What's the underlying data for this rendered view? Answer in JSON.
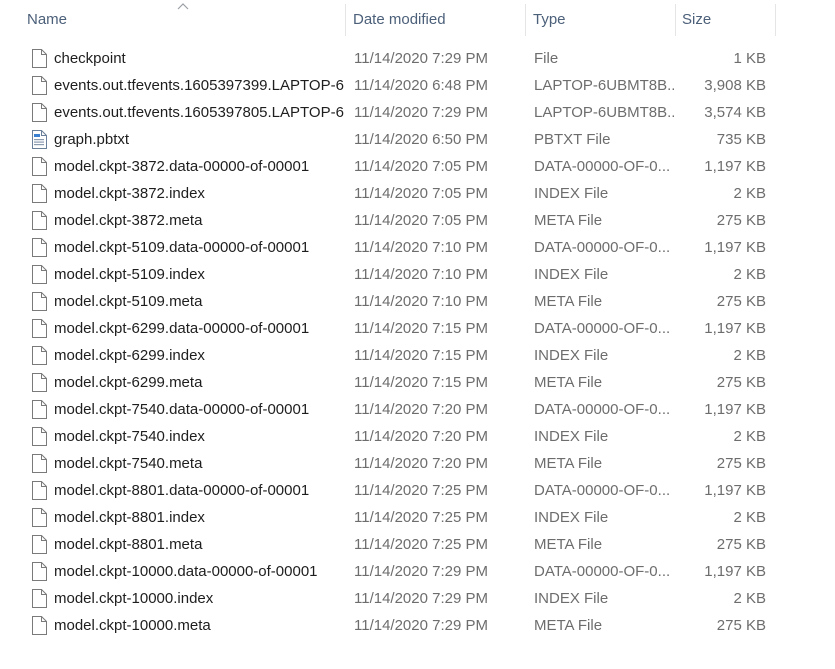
{
  "columns": {
    "name": "Name",
    "date": "Date modified",
    "type": "Type",
    "size": "Size"
  },
  "sort": {
    "column": "name",
    "direction": "ascending",
    "icon": "chevron-up-icon"
  },
  "files": [
    {
      "name": "checkpoint",
      "date": "11/14/2020 7:29 PM",
      "type": "File",
      "size": "1 KB",
      "icon": "generic-file-icon"
    },
    {
      "name": "events.out.tfevents.1605397399.LAPTOP-6...",
      "date": "11/14/2020 6:48 PM",
      "type": "LAPTOP-6UBMT8B...",
      "size": "3,908 KB",
      "icon": "generic-file-icon"
    },
    {
      "name": "events.out.tfevents.1605397805.LAPTOP-6...",
      "date": "11/14/2020 7:29 PM",
      "type": "LAPTOP-6UBMT8B...",
      "size": "3,574 KB",
      "icon": "generic-file-icon"
    },
    {
      "name": "graph.pbtxt",
      "date": "11/14/2020 6:50 PM",
      "type": "PBTXT File",
      "size": "735 KB",
      "icon": "text-document-icon"
    },
    {
      "name": "model.ckpt-3872.data-00000-of-00001",
      "date": "11/14/2020 7:05 PM",
      "type": "DATA-00000-OF-0...",
      "size": "1,197 KB",
      "icon": "generic-file-icon"
    },
    {
      "name": "model.ckpt-3872.index",
      "date": "11/14/2020 7:05 PM",
      "type": "INDEX File",
      "size": "2 KB",
      "icon": "generic-file-icon"
    },
    {
      "name": "model.ckpt-3872.meta",
      "date": "11/14/2020 7:05 PM",
      "type": "META File",
      "size": "275 KB",
      "icon": "generic-file-icon"
    },
    {
      "name": "model.ckpt-5109.data-00000-of-00001",
      "date": "11/14/2020 7:10 PM",
      "type": "DATA-00000-OF-0...",
      "size": "1,197 KB",
      "icon": "generic-file-icon"
    },
    {
      "name": "model.ckpt-5109.index",
      "date": "11/14/2020 7:10 PM",
      "type": "INDEX File",
      "size": "2 KB",
      "icon": "generic-file-icon"
    },
    {
      "name": "model.ckpt-5109.meta",
      "date": "11/14/2020 7:10 PM",
      "type": "META File",
      "size": "275 KB",
      "icon": "generic-file-icon"
    },
    {
      "name": "model.ckpt-6299.data-00000-of-00001",
      "date": "11/14/2020 7:15 PM",
      "type": "DATA-00000-OF-0...",
      "size": "1,197 KB",
      "icon": "generic-file-icon"
    },
    {
      "name": "model.ckpt-6299.index",
      "date": "11/14/2020 7:15 PM",
      "type": "INDEX File",
      "size": "2 KB",
      "icon": "generic-file-icon"
    },
    {
      "name": "model.ckpt-6299.meta",
      "date": "11/14/2020 7:15 PM",
      "type": "META File",
      "size": "275 KB",
      "icon": "generic-file-icon"
    },
    {
      "name": "model.ckpt-7540.data-00000-of-00001",
      "date": "11/14/2020 7:20 PM",
      "type": "DATA-00000-OF-0...",
      "size": "1,197 KB",
      "icon": "generic-file-icon"
    },
    {
      "name": "model.ckpt-7540.index",
      "date": "11/14/2020 7:20 PM",
      "type": "INDEX File",
      "size": "2 KB",
      "icon": "generic-file-icon"
    },
    {
      "name": "model.ckpt-7540.meta",
      "date": "11/14/2020 7:20 PM",
      "type": "META File",
      "size": "275 KB",
      "icon": "generic-file-icon"
    },
    {
      "name": "model.ckpt-8801.data-00000-of-00001",
      "date": "11/14/2020 7:25 PM",
      "type": "DATA-00000-OF-0...",
      "size": "1,197 KB",
      "icon": "generic-file-icon"
    },
    {
      "name": "model.ckpt-8801.index",
      "date": "11/14/2020 7:25 PM",
      "type": "INDEX File",
      "size": "2 KB",
      "icon": "generic-file-icon"
    },
    {
      "name": "model.ckpt-8801.meta",
      "date": "11/14/2020 7:25 PM",
      "type": "META File",
      "size": "275 KB",
      "icon": "generic-file-icon"
    },
    {
      "name": "model.ckpt-10000.data-00000-of-00001",
      "date": "11/14/2020 7:29 PM",
      "type": "DATA-00000-OF-0...",
      "size": "1,197 KB",
      "icon": "generic-file-icon"
    },
    {
      "name": "model.ckpt-10000.index",
      "date": "11/14/2020 7:29 PM",
      "type": "INDEX File",
      "size": "2 KB",
      "icon": "generic-file-icon"
    },
    {
      "name": "model.ckpt-10000.meta",
      "date": "11/14/2020 7:29 PM",
      "type": "META File",
      "size": "275 KB",
      "icon": "generic-file-icon"
    }
  ],
  "colors": {
    "header_text": "#4c607a",
    "name_text": "#1e1e1e",
    "detail_text": "#6d6d6d",
    "divider": "#e5e5e5",
    "background": "#ffffff"
  }
}
